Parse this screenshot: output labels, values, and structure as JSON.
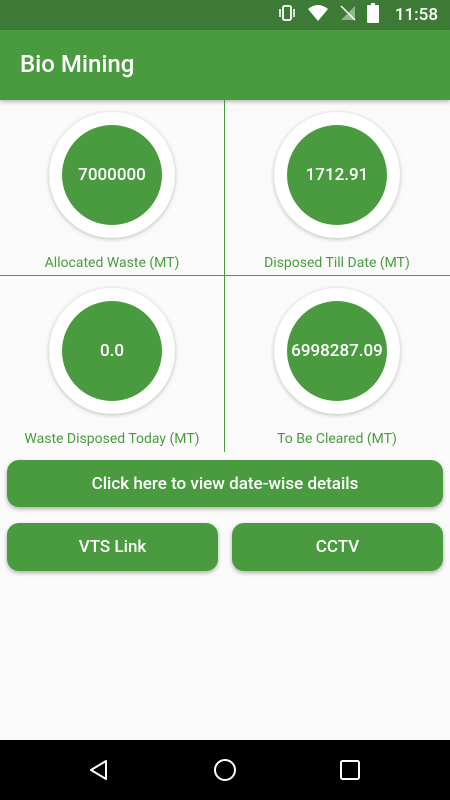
{
  "status_bar": {
    "time": "11:58",
    "icons": [
      "vibrate-icon",
      "wifi-icon",
      "no-signal-icon",
      "battery-icon"
    ]
  },
  "app_bar": {
    "title": "Bio Mining"
  },
  "stats": [
    {
      "value": "7000000",
      "label": "Allocated Waste (MT)"
    },
    {
      "value": "1712.91",
      "label": "Disposed Till Date (MT)"
    },
    {
      "value": "0.0",
      "label": "Waste Disposed Today (MT)"
    },
    {
      "value": "6998287.09",
      "label": "To Be Cleared (MT)"
    }
  ],
  "buttons": {
    "date_wise": "Click here to view date-wise details",
    "vts": "VTS Link",
    "cctv": "CCTV"
  },
  "nav": {
    "icons": [
      "back-icon",
      "home-icon",
      "recents-icon"
    ]
  },
  "colors": {
    "status_bar": "#3d7a35",
    "primary": "#4a9b3f",
    "background": "#fafafa"
  }
}
